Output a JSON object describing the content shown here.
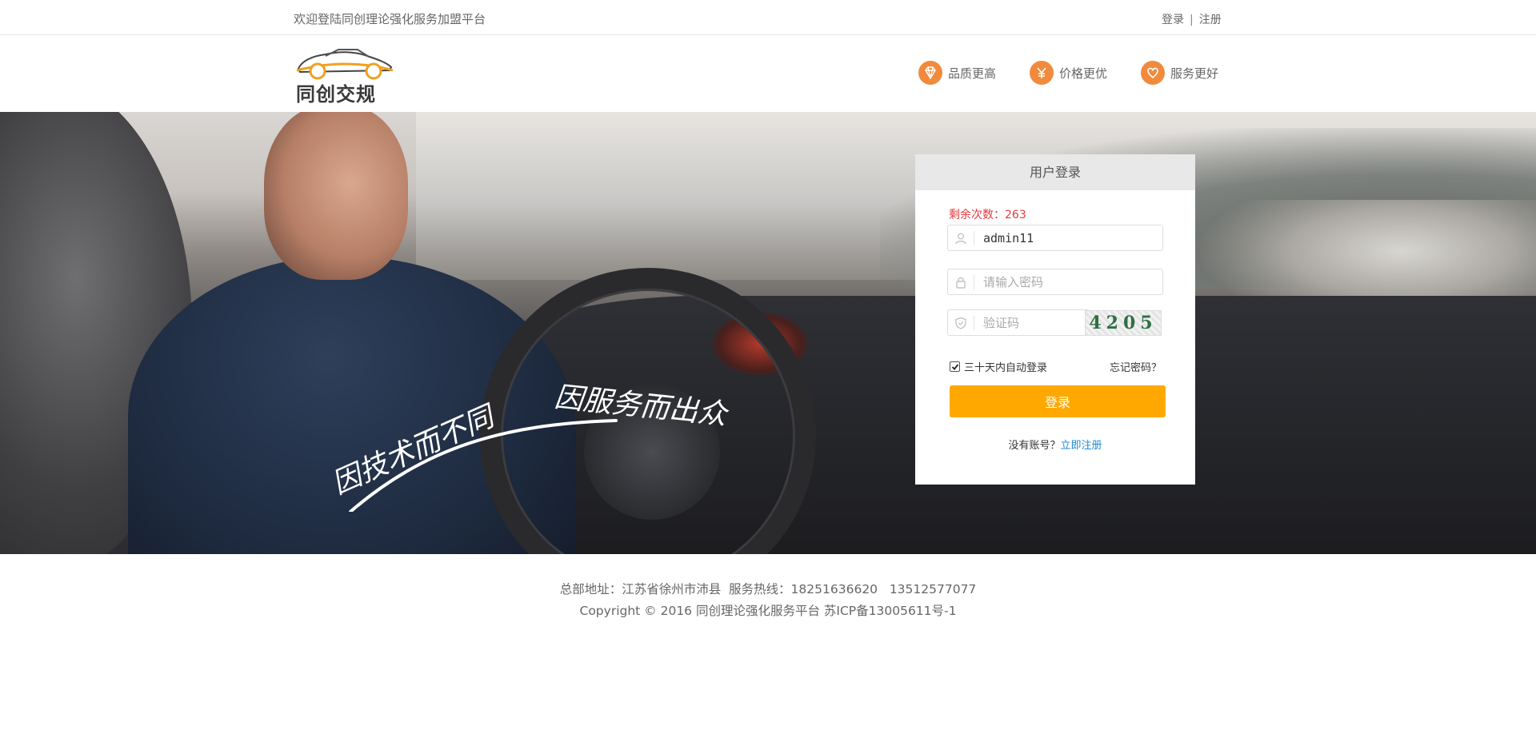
{
  "topbar": {
    "welcome": "欢迎登陆同创理论强化服务加盟平台",
    "login_link": "登录",
    "separator": "|",
    "register_link": "注册"
  },
  "header": {
    "logo_text": "同创交规",
    "features": [
      {
        "label": "品质更高",
        "icon": "diamond-icon"
      },
      {
        "label": "价格更优",
        "icon": "yen-icon"
      },
      {
        "label": "服务更好",
        "icon": "heart-icon"
      }
    ],
    "accent_color": "#f18a3c"
  },
  "banner": {
    "slogan_left": "因技术而不同",
    "slogan_right": "因服务而出众"
  },
  "login": {
    "title": "用户登录",
    "remaining_label": "剩余次数：263",
    "username_value": "admin11",
    "password_placeholder": "请输入密码",
    "captcha_placeholder": "验证码",
    "captcha_text": "4205",
    "remember_label": "三十天内自动登录",
    "remember_checked": true,
    "forgot_label": "忘记密码？",
    "submit_label": "登录",
    "no_account_text": "没有账号？",
    "register_now": "立即注册",
    "button_color": "#ffa800",
    "link_color": "#1a8bd8",
    "warning_color": "#e4393c"
  },
  "footer": {
    "address_line": "总部地址：江苏省徐州市沛县  服务热线：18251636620   13512577077",
    "copyright_line": "Copyright © 2016 同创理论强化服务平台 苏ICP备13005611号-1"
  }
}
